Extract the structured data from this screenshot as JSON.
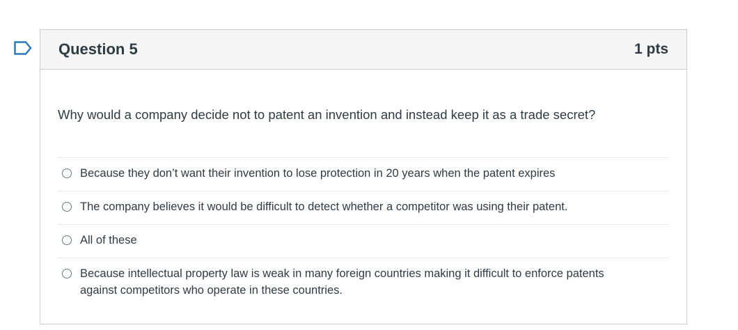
{
  "question": {
    "title": "Question 5",
    "points": "1 pts",
    "text": "Why would a company decide not to patent an invention and instead keep it as a trade secret?",
    "answers": [
      {
        "label": "Because they don’t want their invention to lose protection in 20 years when the patent expires"
      },
      {
        "label": "The company believes it would be difficult to detect whether a competitor was using their patent."
      },
      {
        "label": "All of these"
      },
      {
        "label": "Because intellectual property law is weak in many foreign countries making it difficult to enforce patents against competitors who operate in these countries."
      }
    ]
  },
  "icons": {
    "flag": "flag-question-icon"
  },
  "colors": {
    "flag": "#2b7abc",
    "text": "#2d3b45",
    "header_bg": "#f5f5f5",
    "border": "#c7cdd1"
  }
}
